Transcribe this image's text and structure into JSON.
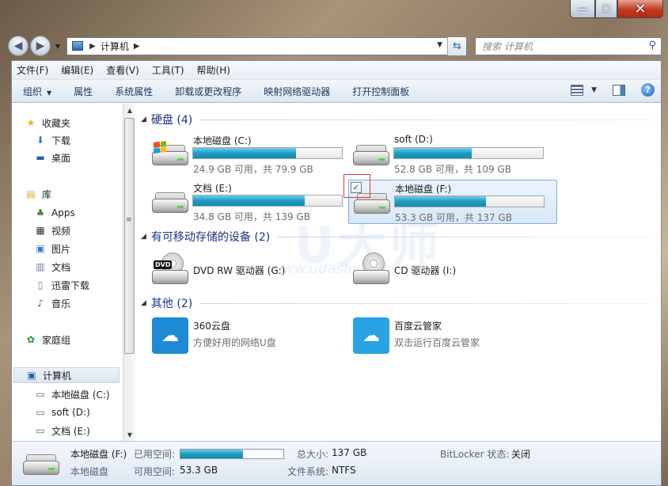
{
  "window": {
    "caption_buttons": {
      "minimize": "—",
      "maximize": "☐",
      "close": "✕"
    }
  },
  "address": {
    "back_icon": "back-arrow-icon",
    "forward_icon": "forward-arrow-icon",
    "path": "计算机",
    "search_placeholder": "搜索 计算机"
  },
  "menu": [
    "文件(F)",
    "编辑(E)",
    "查看(V)",
    "工具(T)",
    "帮助(H)"
  ],
  "toolbar": {
    "organize": "组织",
    "properties": "属性",
    "system_properties": "系统属性",
    "uninstall": "卸载或更改程序",
    "map_drive": "映射网络驱动器",
    "control_panel": "打开控制面板"
  },
  "nav": {
    "favorites": "收藏夹",
    "downloads": "下载",
    "desktop": "桌面",
    "libraries": "库",
    "apps": "Apps",
    "videos": "视频",
    "pictures": "图片",
    "documents": "文档",
    "xunlei": "迅雷下载",
    "music": "音乐",
    "homegroup": "家庭组",
    "computer": "计算机",
    "drive_c": "本地磁盘 (C:)",
    "drive_d": "soft (D:)",
    "drive_e": "文档 (E:)"
  },
  "groups": {
    "hard_disks": "硬盘 (4)",
    "removable": "有可移动存储的设备 (2)",
    "other": "其他 (2)"
  },
  "drives": [
    {
      "name": "本地磁盘 (C:)",
      "info": "24.9 GB 可用，共 79.9 GB",
      "used_fraction": 0.69
    },
    {
      "name": "soft (D:)",
      "info": "52.8 GB 可用，共 109 GB",
      "used_fraction": 0.52
    },
    {
      "name": "文档 (E:)",
      "info": "34.8 GB 可用，共 139 GB",
      "used_fraction": 0.75
    },
    {
      "name": "本地磁盘 (F:)",
      "info": "53.3 GB 可用，共 137 GB",
      "used_fraction": 0.61
    }
  ],
  "removable_devices": [
    {
      "name": "DVD RW 驱动器 (G:)",
      "badge": "DVD"
    },
    {
      "name": "CD 驱动器 (I:)"
    }
  ],
  "others": [
    {
      "name": "360云盘",
      "sub": "方便好用的网络U盘",
      "color": "#1e8ad6"
    },
    {
      "name": "百度云管家",
      "sub": "双击运行百度云管家",
      "color": "#27a3e4"
    }
  ],
  "watermark": {
    "main": "U大师",
    "url": "www.udashi.com"
  },
  "details": {
    "name": "本地磁盘 (F:)",
    "type": "本地磁盘",
    "used_label": "已用空间:",
    "free_label": "可用空间:",
    "free_value": "53.3 GB",
    "total_label": "总大小:",
    "total_value": "137 GB",
    "fs_label": "文件系统:",
    "fs_value": "NTFS",
    "bitlocker_label": "BitLocker 状态:",
    "bitlocker_value": "关闭",
    "used_fraction": 0.61
  },
  "colors": {
    "accent": "#1e9bc1",
    "group_title": "#1e3287",
    "selection_border": "#84acdd",
    "annotation_red": "#d53d3d"
  }
}
